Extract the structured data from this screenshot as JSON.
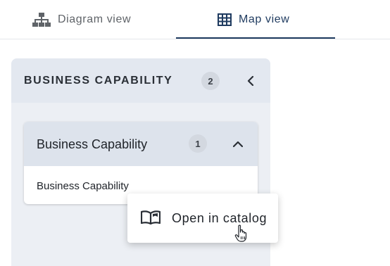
{
  "tabs": {
    "diagram_label": "Diagram view",
    "map_label": "Map view",
    "active": "Map view"
  },
  "panel": {
    "title": "BUSINESS CAPABILITY",
    "count": "2"
  },
  "group": {
    "title": "Business Capability",
    "count": "1",
    "items": [
      "Business Capability"
    ]
  },
  "context_menu": {
    "item_label": "Open in catalog",
    "item_icon": "open-book-icon"
  },
  "colors": {
    "accent": "#1e3a5f",
    "panel_bg": "#eceff4",
    "header_bg": "#e3e8f0",
    "group_header_bg": "#dde3ec"
  }
}
